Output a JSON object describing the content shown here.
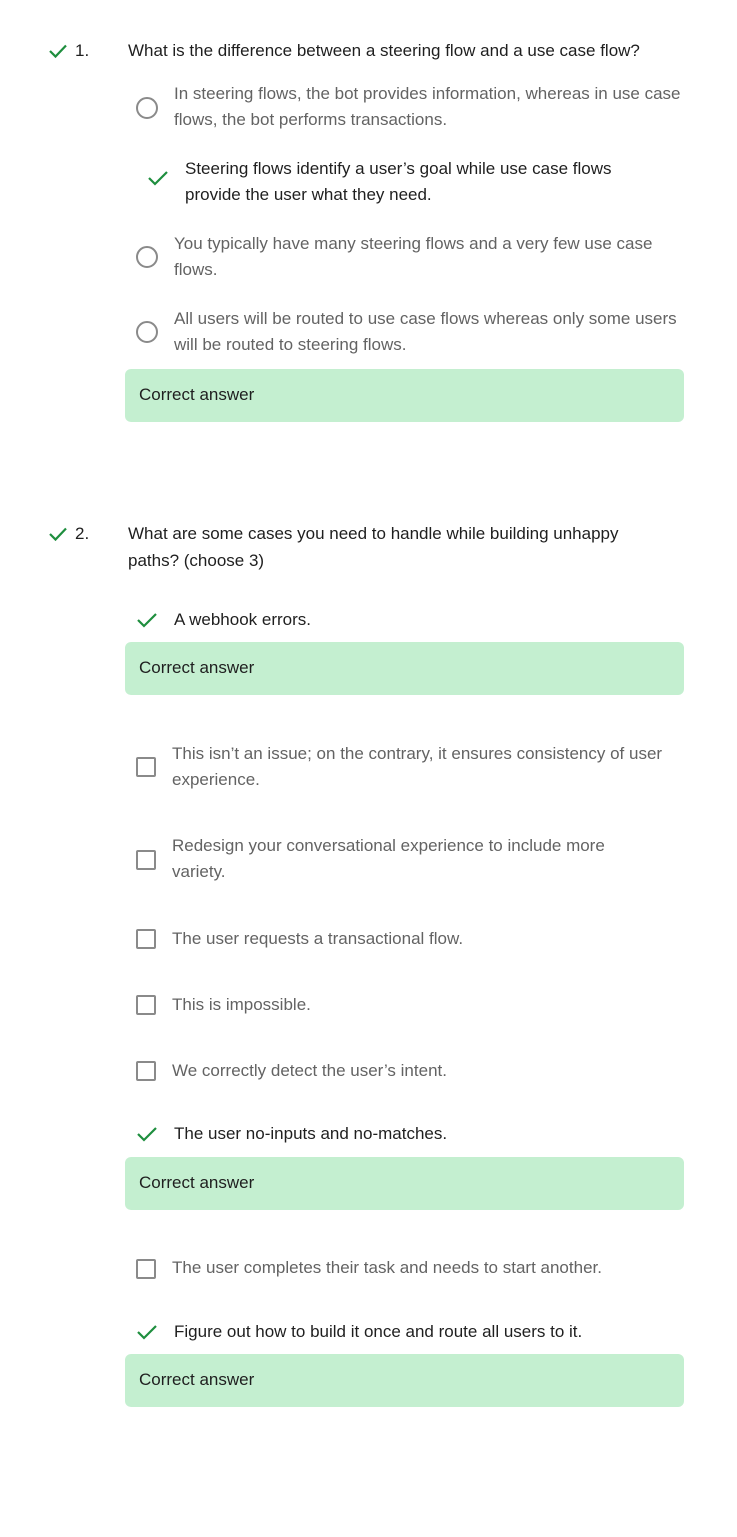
{
  "colors": {
    "correct": "#1e8e3e",
    "feedback_bg": "#c4efd0",
    "muted_text": "#636363",
    "text": "#1f1f1f"
  },
  "questions": [
    {
      "number": "1.",
      "status_icon": "check-icon",
      "text": "What is the difference between a steering flow and a use case flow?",
      "input_type": "radio",
      "options": [
        {
          "text": "In steering flows, the bot provides information, whereas in use case flows, the bot performs transactions.",
          "selected": false
        },
        {
          "text": "Steering flows identify a user’s goal while use case flows provide the user what they need.",
          "selected": true
        },
        {
          "text": "You typically have many steering flows and a very few use case flows.",
          "selected": false
        },
        {
          "text": "All users will be routed to use case flows whereas only some users will be routed to steering flows.",
          "selected": false
        }
      ],
      "feedback": "Correct answer"
    },
    {
      "number": "2.",
      "status_icon": "check-icon",
      "text": "What are some cases you need to handle while building unhappy paths? (choose 3)",
      "input_type": "checkbox",
      "options": [
        {
          "text": "A webhook errors.",
          "selected": true,
          "feedback": "Correct answer"
        },
        {
          "text": "This isn’t an issue; on the contrary, it ensures consistency of user experience.",
          "selected": false
        },
        {
          "text": "Redesign your conversational experience to include more variety.",
          "selected": false
        },
        {
          "text": "The user requests a transactional flow.",
          "selected": false
        },
        {
          "text": "This is impossible.",
          "selected": false
        },
        {
          "text": "We correctly detect the user’s intent.",
          "selected": false
        },
        {
          "text": "The user no-inputs and no-matches.",
          "selected": true,
          "feedback": "Correct answer"
        },
        {
          "text": "The user completes their task and needs to start another.",
          "selected": false
        },
        {
          "text": "Figure out how to build it once and route all users to it.",
          "selected": true,
          "feedback": "Correct answer"
        }
      ]
    }
  ]
}
